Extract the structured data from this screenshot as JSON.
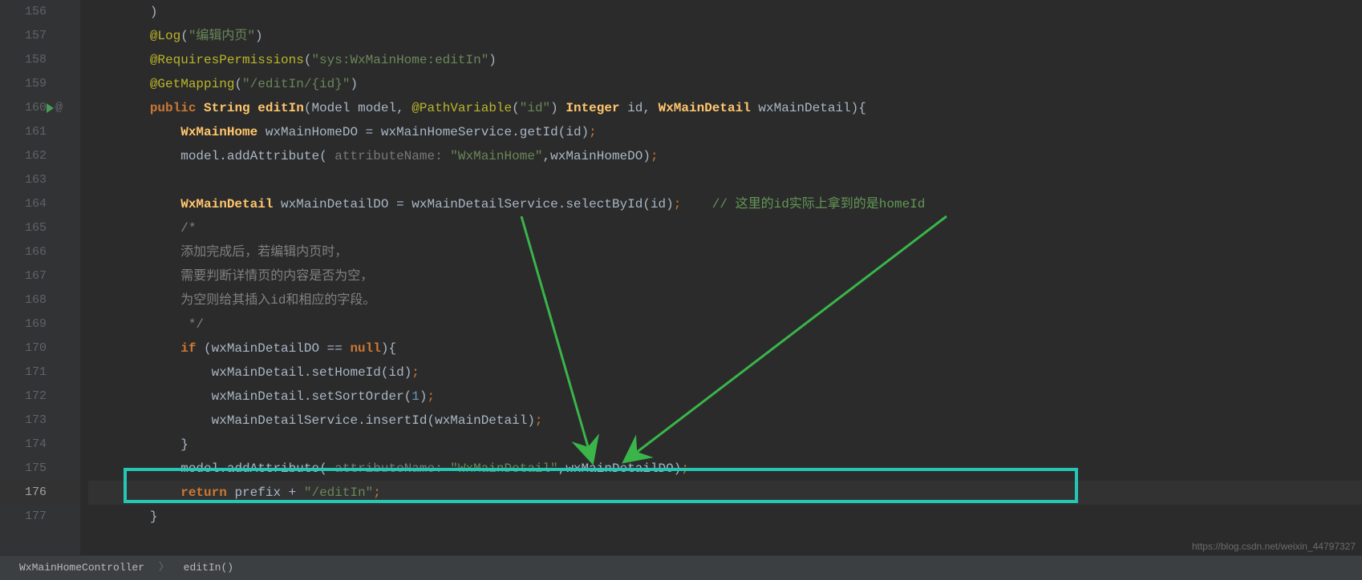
{
  "gutter": {
    "start": 156,
    "lines": [
      156,
      157,
      158,
      159,
      160,
      161,
      162,
      163,
      164,
      165,
      166,
      167,
      168,
      169,
      170,
      171,
      172,
      173,
      174,
      175,
      176,
      177
    ],
    "active_line": 176,
    "run_marker_line": 160,
    "bulb_line": 176
  },
  "code": {
    "line156": ")",
    "line157_ann": "@Log",
    "line157_str": "\"编辑内页\"",
    "line158_ann": "@RequiresPermissions",
    "line158_str": "\"sys:WxMainHome:editIn\"",
    "line159_ann": "@GetMapping",
    "line159_str": "\"/editIn/{id}\"",
    "line160_kw1": "public",
    "line160_type": "String",
    "line160_method": "editIn",
    "line160_p1t": "Model",
    "line160_p1n": "model",
    "line160_ann": "@PathVariable",
    "line160_annstr": "\"id\"",
    "line160_p2t": "Integer",
    "line160_p2n": "id",
    "line160_p3t": "WxMainDetail",
    "line160_p3n": "wxMainDetail",
    "line161_type": "WxMainHome",
    "line161_var": "wxMainHomeDO",
    "line161_svc": "wxMainHomeService",
    "line161_call": "getId",
    "line161_arg": "id",
    "line162_obj": "model",
    "line162_call": "addAttribute",
    "line162_hint": "attributeName:",
    "line162_str": "\"WxMainHome\"",
    "line162_arg2": "wxMainHomeDO",
    "line164_type": "WxMainDetail",
    "line164_var": "wxMainDetailDO",
    "line164_svc": "wxMainDetailService",
    "line164_call": "selectById",
    "line164_arg": "id",
    "line164_cmt": "// 这里的id实际上拿到的是homeId",
    "line165": "/*",
    "line166": "添加完成后，若编辑内页时，",
    "line167": "需要判断详情页的内容是否为空，",
    "line168": "为空则给其插入id和相应的字段。",
    "line169": " */",
    "line170_kw": "if",
    "line170_cond": "wxMainDetailDO",
    "line170_null": "null",
    "line171_obj": "wxMainDetail",
    "line171_call": "setHomeId",
    "line171_arg": "id",
    "line172_obj": "wxMainDetail",
    "line172_call": "setSortOrder",
    "line172_arg": "1",
    "line173_obj": "wxMainDetailService",
    "line173_call": "insertId",
    "line173_arg": "wxMainDetail",
    "line174": "}",
    "line175_obj": "model",
    "line175_call": "addAttribute",
    "line175_hint": "attributeName:",
    "line175_str": "\"WxMainDetail\"",
    "line175_arg2": "wxMainDetailDO",
    "line176_kw": "return",
    "line176_var": "prefix",
    "line176_str": "\"/editIn\"",
    "line177": "}"
  },
  "breadcrumb": {
    "item1": "WxMainHomeController",
    "item2": "editIn()"
  },
  "watermark": "https://blog.csdn.net/weixin_44797327"
}
